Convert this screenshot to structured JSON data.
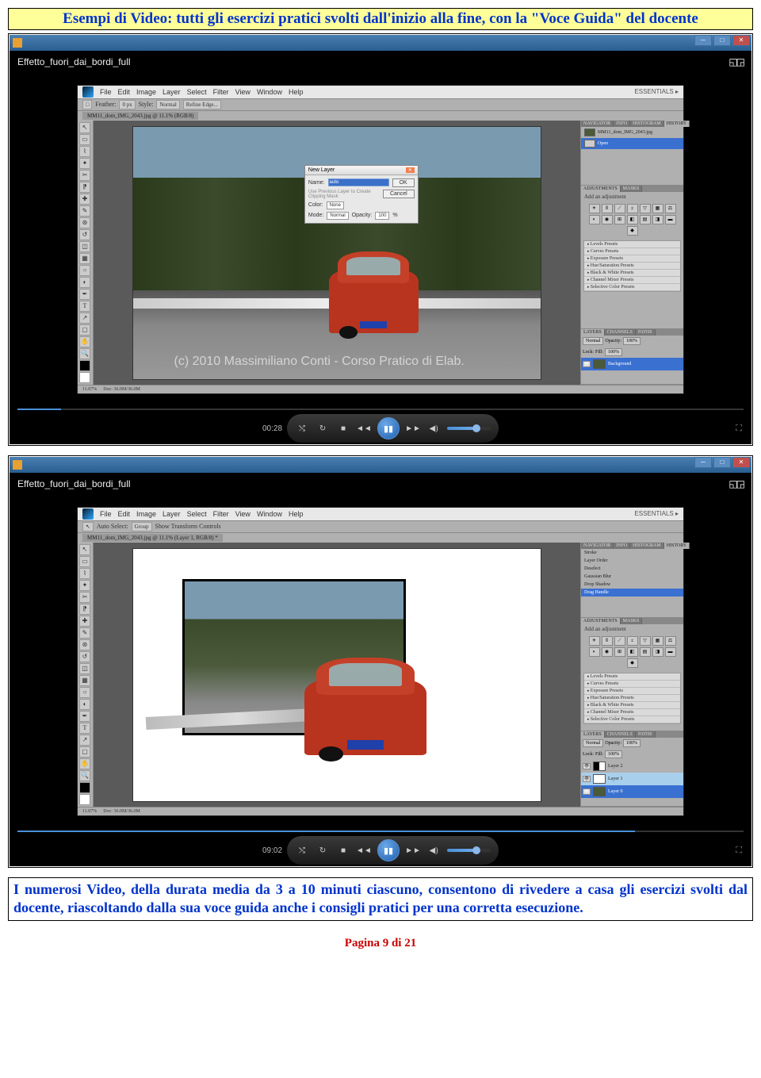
{
  "title": "Esempi di Video: tutti gli esercizi pratici svolti dall'inizio alla fine, con la \"Voce Guida\" del docente",
  "caption": "I numerosi Video, della durata media da 3 a 10 minuti ciascuno, consentono di rivedere a casa gli esercizi svolti dal docente, riascoltando dalla sua voce guida anche i consigli pratici per una corretta esecuzione.",
  "page_number": "Pagina 9 di 21",
  "player": {
    "video_title": "Effetto_fuori_dai_bordi_full",
    "time1": "00:28",
    "time2": "09:02",
    "controls": {
      "shuffle": "⤭",
      "repeat": "↻",
      "stop": "■",
      "prev": "◄◄",
      "play": "▮▮",
      "next": "►►",
      "mute": "◀)"
    },
    "fullscreen": "⛶"
  },
  "photoshop": {
    "menu": [
      "File",
      "Edit",
      "Image",
      "Layer",
      "Select",
      "Filter",
      "View",
      "Window",
      "Help"
    ],
    "essentials": "ESSENTIALS ▸",
    "tab_name": "MM11_dom_IMG_2043.jpg @ 11.1% (RGB/8)",
    "tab_name2": "MM11_dom_IMG_2043.jpg @ 11.1% (Layer 1, RGB/8) *",
    "options1": {
      "feather": "Feather:",
      "px": "0 px",
      "style": "Style:",
      "normal": "Normal",
      "refine": "Refine Edge..."
    },
    "options2": {
      "auto": "Auto Select:",
      "group": "Group",
      "show": "Show Transform Controls"
    },
    "watermark": "(c) 2010 Massimiliano Conti - Corso Pratico di Elab.",
    "status": {
      "zoom": "11.07%",
      "doc": "Doc: 36.0M/36.0M"
    },
    "dialog": {
      "title": "New Layer",
      "name_label": "Name:",
      "name_value": "auto",
      "clip": "Use Previous Layer to Create Clipping Mask",
      "color_label": "Color:",
      "color_value": "None",
      "mode_label": "Mode:",
      "mode_value": "Normal",
      "opacity_label": "Opacity:",
      "opacity_value": "100",
      "percent": "%",
      "ok": "OK",
      "cancel": "Cancel"
    },
    "panels": {
      "history_tabs": [
        "NAVIGATOR",
        "INFO",
        "HISTOGRAM",
        "HISTORY"
      ],
      "history1_items": [
        {
          "name": "MM11_dom_IMG_2043.jpg",
          "sel": false
        },
        {
          "name": "Open",
          "sel": true
        }
      ],
      "history2_items": [
        {
          "name": "Stroke",
          "sel": false
        },
        {
          "name": "Layer Order",
          "sel": false
        },
        {
          "name": "Deselect",
          "sel": false
        },
        {
          "name": "Gaussian Blur",
          "sel": false
        },
        {
          "name": "Drop Shadow",
          "sel": false
        },
        {
          "name": "Drag Handle",
          "sel": true
        }
      ],
      "adjustments_tabs": [
        "ADJUSTMENTS",
        "MASKS"
      ],
      "adjustments_header": "Add an adjustment",
      "presets": [
        "Levels Presets",
        "Curves Presets",
        "Exposure Presets",
        "Hue/Saturation Presets",
        "Black & White Presets",
        "Channel Mixer Presets",
        "Selective Color Presets"
      ],
      "layers_tabs": [
        "LAYERS",
        "CHANNELS",
        "PATHS"
      ],
      "layers_normal": "Normal",
      "layers_opacity": "Opacity:",
      "layers_opval": "100%",
      "layers_lock": "Lock:",
      "layers_fill": "Fill:",
      "layers_fillval": "100%",
      "layers1": [
        {
          "name": "Background",
          "bg": true
        }
      ],
      "layers2": [
        {
          "name": "Layer 2",
          "thumb": "bw"
        },
        {
          "name": "Layer 1",
          "thumb": "w",
          "sel2": true
        },
        {
          "name": "Layer 0",
          "thumb": "",
          "sel": true
        }
      ]
    }
  }
}
